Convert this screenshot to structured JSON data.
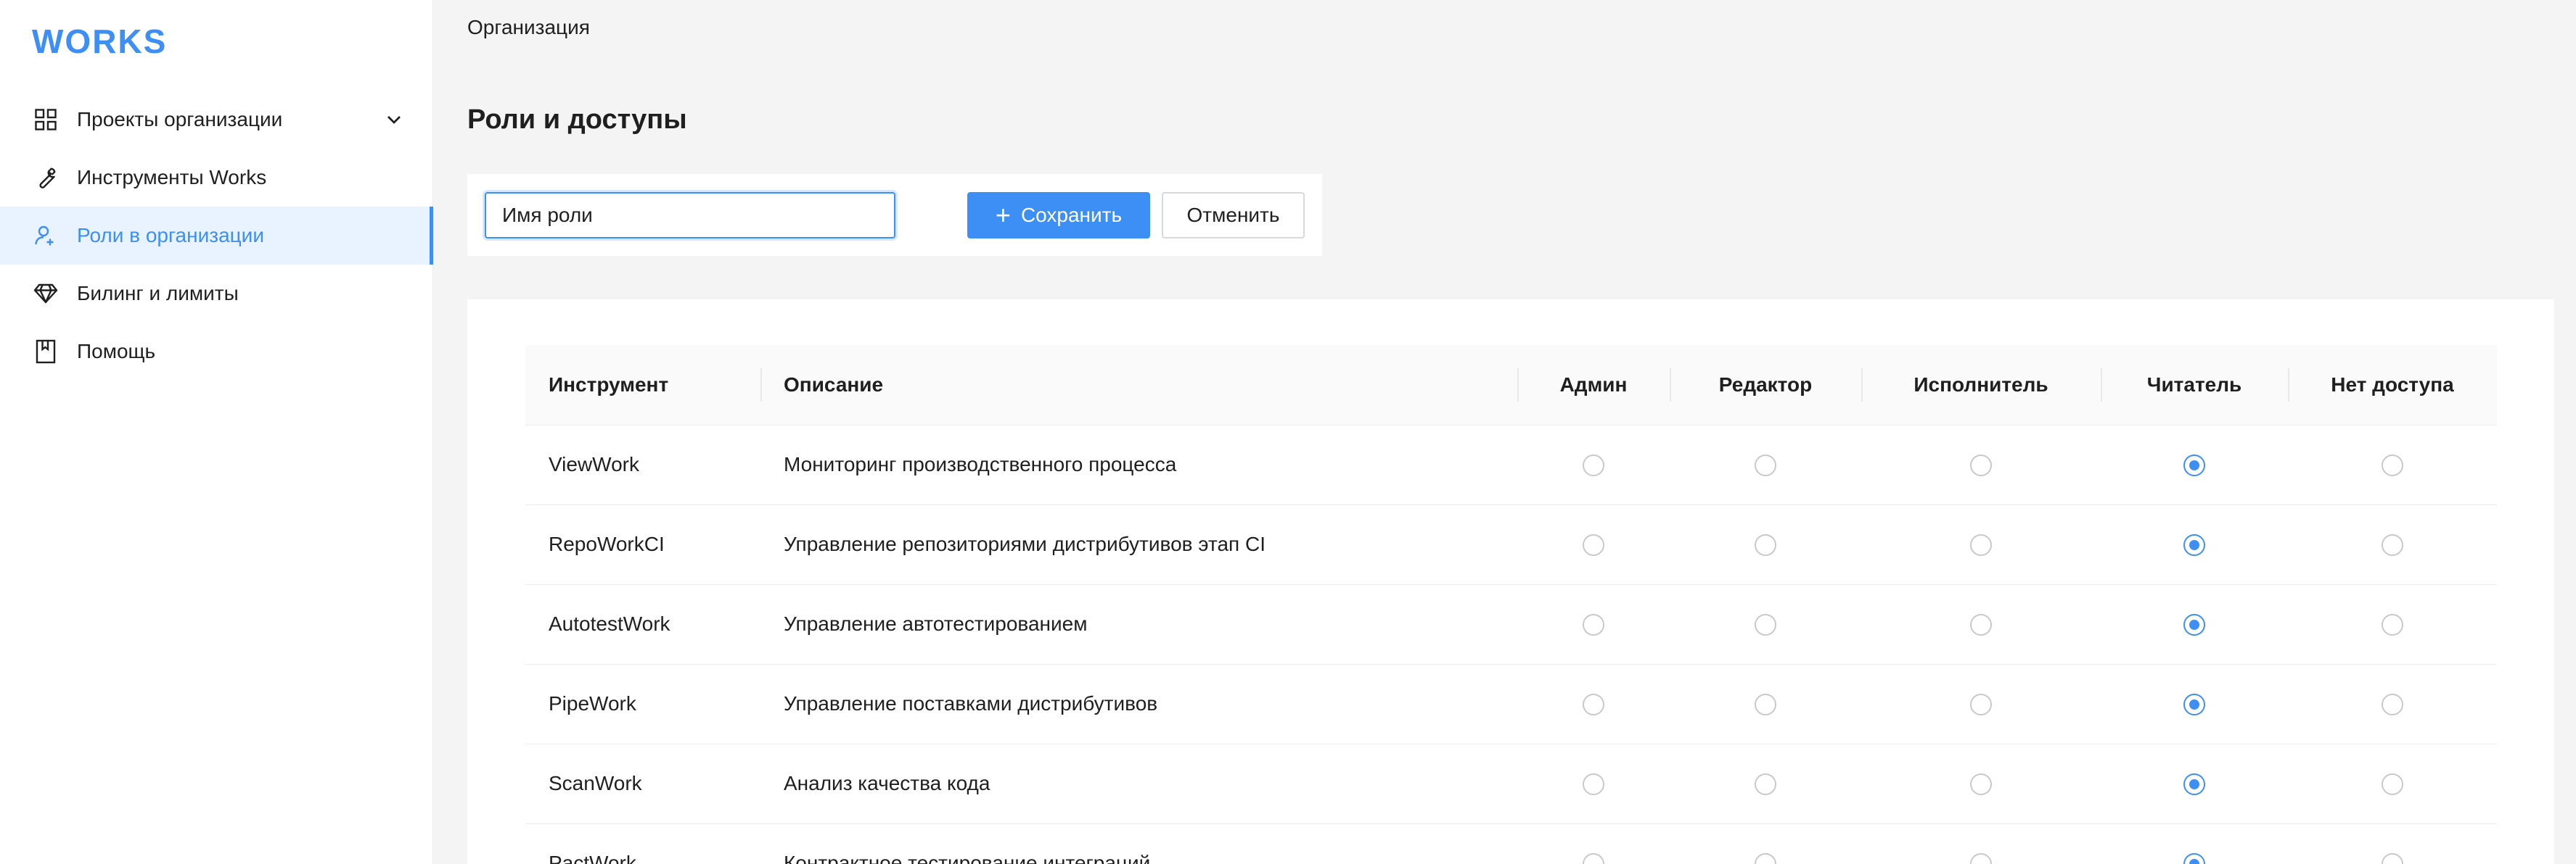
{
  "app": {
    "logo": "WORKS",
    "accent": "#3d8ff5"
  },
  "sidebar": {
    "items": [
      {
        "label": "Проекты организации",
        "icon": "grid-icon",
        "has_chevron": true,
        "active": false
      },
      {
        "label": "Инструменты Works",
        "icon": "wrench-icon",
        "active": false
      },
      {
        "label": "Роли в организации",
        "icon": "user-role-icon",
        "active": true
      },
      {
        "label": "Билинг и лимиты",
        "icon": "diamond-icon",
        "active": false
      },
      {
        "label": "Помощь",
        "icon": "book-icon",
        "active": false
      }
    ]
  },
  "breadcrumb": "Организация",
  "page_title": "Роли и доступы",
  "toolbar": {
    "role_name_value": "Имя роли",
    "save_label": "Сохранить",
    "cancel_label": "Отменить"
  },
  "table": {
    "columns": [
      "Инструмент",
      "Описание",
      "Админ",
      "Редактор",
      "Исполнитель",
      "Читатель",
      "Нет доступа"
    ],
    "rows": [
      {
        "tool": "ViewWork",
        "description": "Мониторинг производственного процесса",
        "selected": "Читатель"
      },
      {
        "tool": "RepoWorkCI",
        "description": "Управление репозиториями дистрибутивов этап CI",
        "selected": "Читатель"
      },
      {
        "tool": "AutotestWork",
        "description": "Управление автотестированием",
        "selected": "Читатель"
      },
      {
        "tool": "PipeWork",
        "description": "Управление поставками дистрибутивов",
        "selected": "Читатель"
      },
      {
        "tool": "ScanWork",
        "description": "Анализ качества кода",
        "selected": "Читатель"
      },
      {
        "tool": "PactWork",
        "description": "Контрактное тестирование интеграций",
        "selected": "Читатель"
      }
    ]
  }
}
